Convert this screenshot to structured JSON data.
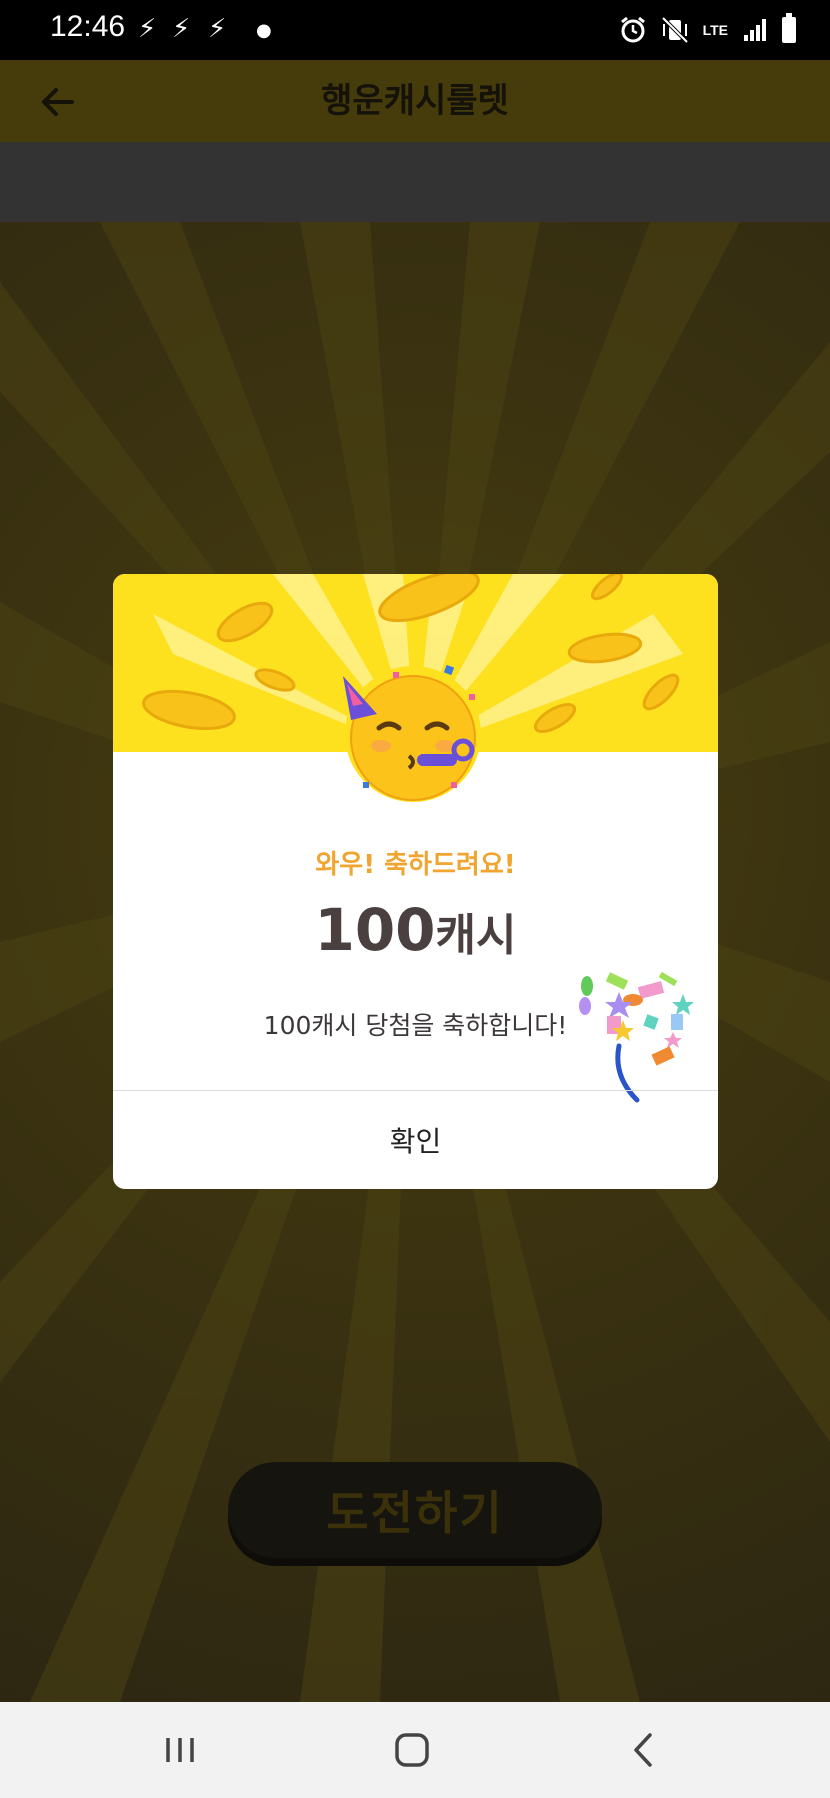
{
  "status_bar": {
    "time": "12:46",
    "network_label": "LTE"
  },
  "app_bar": {
    "title": "행운캐시룰렛"
  },
  "game": {
    "challenge_label": "도전하기"
  },
  "modal": {
    "congrats_text": "와우! 축하드려요!",
    "amount_number": "100",
    "amount_unit": "캐시",
    "message": "100캐시 당첨을 축하합니다!",
    "confirm_label": "확인"
  },
  "icons": {
    "back": "arrow-left-icon",
    "alarm": "alarm-icon",
    "mute": "vibrate-mute-icon",
    "signal": "signal-icon",
    "battery": "battery-icon",
    "nav_recent": "recent-apps-icon",
    "nav_home": "home-icon",
    "nav_back": "back-chevron-icon"
  },
  "colors": {
    "accent_yellow": "#fde11f",
    "congrats_orange": "#f0a531",
    "overlay_dark": "#2f2a14"
  }
}
